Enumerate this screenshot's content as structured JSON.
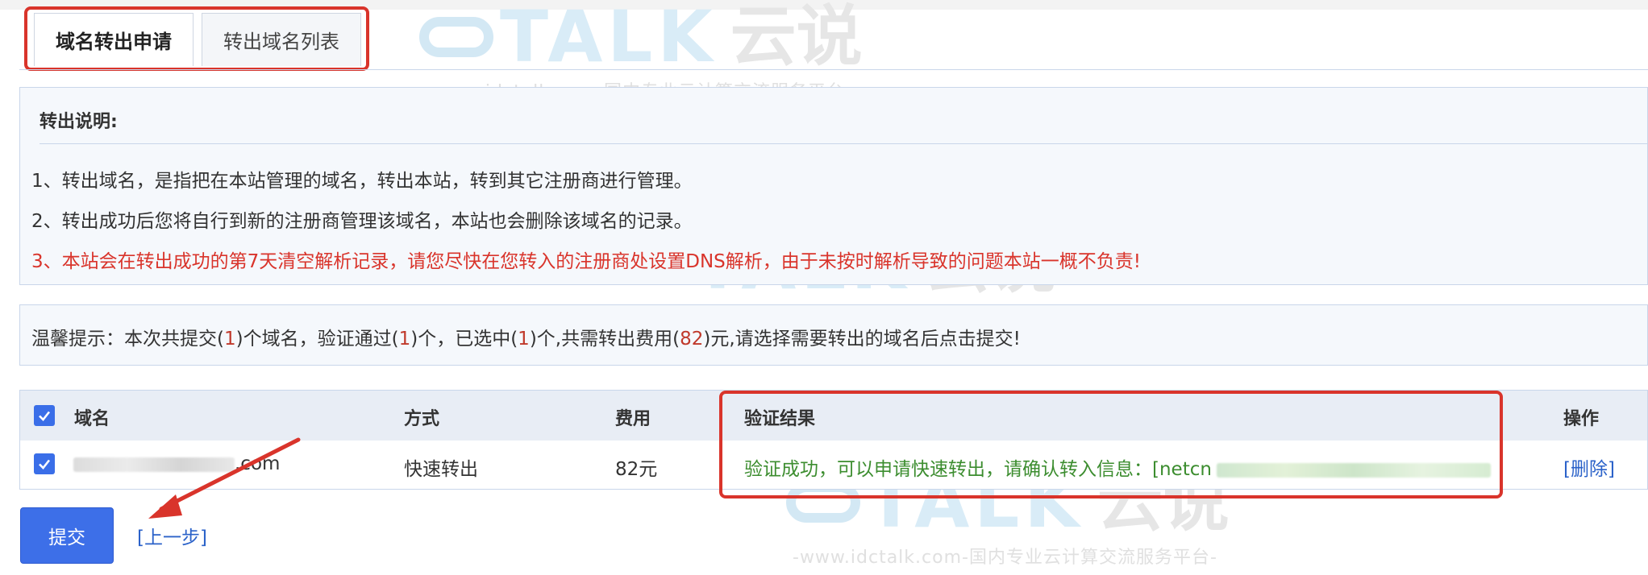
{
  "tabs": [
    {
      "label": "域名转出申请",
      "active": true
    },
    {
      "label": "转出域名列表",
      "active": false
    }
  ],
  "watermark": {
    "brand": "TALK",
    "brand_cn": "云说",
    "subtitle": "-www.idctalk.com-国内专业云计算交流服务平台-"
  },
  "notice": {
    "title": "转出说明:",
    "items": [
      "1、转出域名，是指把在本站管理的域名，转出本站，转到其它注册商进行管理。",
      "2、转出成功后您将自行到新的注册商管理该域名，本站也会删除该域名的记录。",
      "3、本站会在转出成功的第7天清空解析记录，请您尽快在您转入的注册商处设置DNS解析，由于未按时解析导致的问题本站一概不负责!"
    ]
  },
  "tip": {
    "p1": "温馨提示：本次共提交(",
    "submitted": "1",
    "p2": ")个域名，验证通过(",
    "verified": "1",
    "p3": ")个，已选中(",
    "selected": "1",
    "p4": ")个,共需转出费用(",
    "fee": "82",
    "p5": ")元,请选择需要转出的域名后点击提交!"
  },
  "table": {
    "headers": {
      "domain": "域名",
      "method": "方式",
      "fee": "费用",
      "result": "验证结果",
      "action": "操作"
    },
    "rows": [
      {
        "domain_suffix": ".com",
        "method": "快速转出",
        "fee": "82元",
        "result": "验证成功，可以申请快速转出，请确认转入信息：[netcn",
        "action": "[删除]"
      }
    ]
  },
  "buttons": {
    "submit": "提交",
    "prev": "[上一步]"
  },
  "colors": {
    "accent": "#3d6fe8",
    "highlight_box": "#d9342b",
    "success": "#3c8d2f",
    "warning": "#d9342b"
  }
}
